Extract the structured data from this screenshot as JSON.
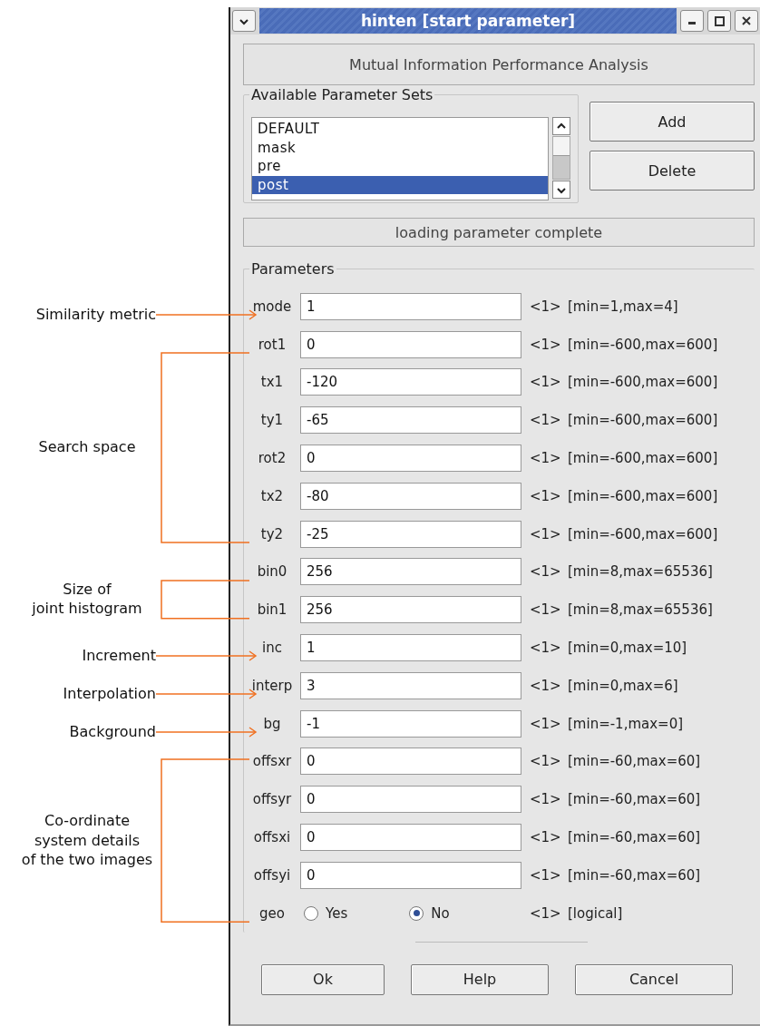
{
  "window": {
    "title": "hinten [start parameter]"
  },
  "header": "Mutual Information Performance Analysis",
  "parameter_sets": {
    "title": "Available Parameter Sets",
    "items": [
      {
        "label": "DEFAULT",
        "selected": false
      },
      {
        "label": "mask",
        "selected": false
      },
      {
        "label": "pre",
        "selected": false
      },
      {
        "label": "post",
        "selected": true
      }
    ]
  },
  "set_buttons": [
    "Add",
    "Delete"
  ],
  "status": "loading parameter complete",
  "parameters": {
    "title": "Parameters",
    "groups": [
      {
        "annotation": "Similarity metric",
        "kind": "arrow",
        "rows": [
          {
            "kind": "field",
            "name": "mode",
            "value": "1",
            "count": "<1>",
            "range": "[min=1,max=4]"
          }
        ]
      },
      {
        "annotation": "Search space",
        "kind": "bracket",
        "rows": [
          {
            "kind": "field",
            "name": "rot1",
            "value": "0",
            "count": "<1>",
            "range": "[min=-600,max=600]"
          },
          {
            "kind": "field",
            "name": "tx1",
            "value": "-120",
            "count": "<1>",
            "range": "[min=-600,max=600]"
          },
          {
            "kind": "field",
            "name": "ty1",
            "value": "-65",
            "count": "<1>",
            "range": "[min=-600,max=600]"
          },
          {
            "kind": "field",
            "name": "rot2",
            "value": "0",
            "count": "<1>",
            "range": "[min=-600,max=600]"
          },
          {
            "kind": "field",
            "name": "tx2",
            "value": "-80",
            "count": "<1>",
            "range": "[min=-600,max=600]"
          },
          {
            "kind": "field",
            "name": "ty2",
            "value": "-25",
            "count": "<1>",
            "range": "[min=-600,max=600]"
          }
        ]
      },
      {
        "annotation": "Size of\njoint histogram",
        "kind": "bracket",
        "rows": [
          {
            "kind": "field",
            "name": "bin0",
            "value": "256",
            "count": "<1>",
            "range": "[min=8,max=65536]"
          },
          {
            "kind": "field",
            "name": "bin1",
            "value": "256",
            "count": "<1>",
            "range": "[min=8,max=65536]"
          }
        ]
      },
      {
        "annotation": "Increment",
        "kind": "arrow",
        "rows": [
          {
            "kind": "field",
            "name": "inc",
            "value": "1",
            "count": "<1>",
            "range": "[min=0,max=10]"
          }
        ]
      },
      {
        "annotation": "Interpolation",
        "kind": "arrow",
        "rows": [
          {
            "kind": "field",
            "name": "interp",
            "value": "3",
            "count": "<1>",
            "range": "[min=0,max=6]"
          }
        ]
      },
      {
        "annotation": "Background",
        "kind": "arrow",
        "rows": [
          {
            "kind": "field",
            "name": "bg",
            "value": "-1",
            "count": "<1>",
            "range": "[min=-1,max=0]"
          }
        ]
      },
      {
        "annotation": "Co-ordinate\nsystem details\nof the two images",
        "kind": "bracket",
        "rows": [
          {
            "kind": "field",
            "name": "offsxr",
            "value": "0",
            "count": "<1>",
            "range": "[min=-60,max=60]"
          },
          {
            "kind": "field",
            "name": "offsyr",
            "value": "0",
            "count": "<1>",
            "range": "[min=-60,max=60]"
          },
          {
            "kind": "field",
            "name": "offsxi",
            "value": "0",
            "count": "<1>",
            "range": "[min=-60,max=60]"
          },
          {
            "kind": "field",
            "name": "offsyi",
            "value": "0",
            "count": "<1>",
            "range": "[min=-60,max=60]"
          },
          {
            "kind": "radio",
            "name": "geo",
            "options": [
              {
                "label": "Yes",
                "selected": false
              },
              {
                "label": "No",
                "selected": true
              }
            ],
            "count": "<1>",
            "range": "[logical]"
          }
        ]
      }
    ]
  },
  "buttons": [
    "Ok",
    "Help",
    "Cancel"
  ]
}
